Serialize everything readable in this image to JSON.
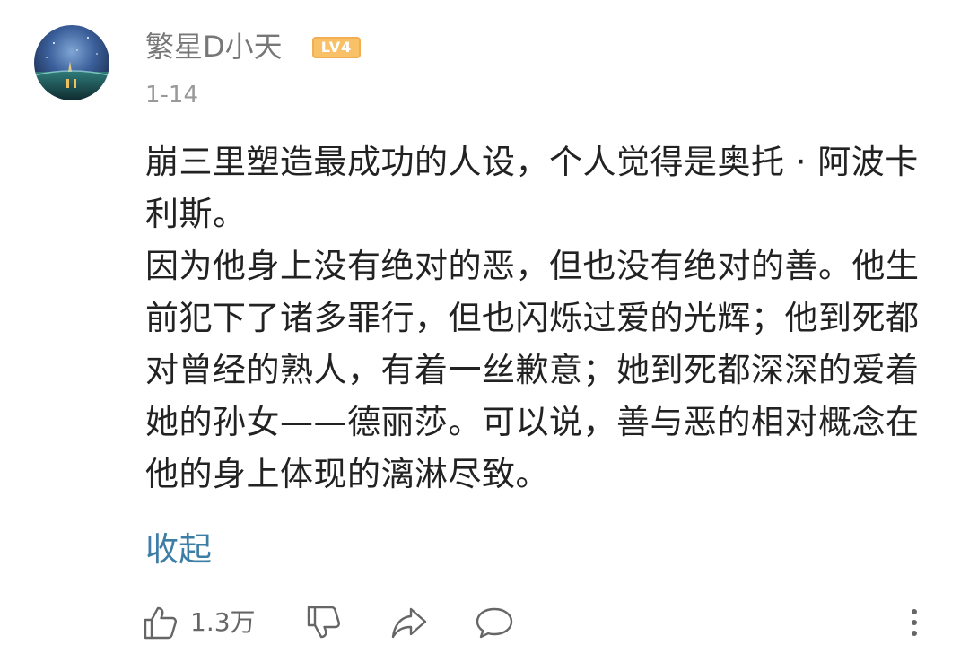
{
  "comment": {
    "username": "繁星D小天",
    "level_badge": "LV4",
    "date": "1-14",
    "paragraphs": [
      "崩三里塑造最成功的人设，个人觉得是奥托 · 阿波卡利斯。",
      "因为他身上没有绝对的恶，但也没有绝对的善。他生前犯下了诸多罪行，但也闪烁过爱的光辉；他到死都对曾经的熟人，有着一丝歉意；她到死都深深的爱着她的孙女——德丽莎。可以说，善与恶的相对概念在他的身上体现的漓淋尽致。"
    ],
    "collapse_label": "收起"
  },
  "actions": {
    "like_count": "1.3万"
  },
  "colors": {
    "username": "#777777",
    "body_text": "#222222",
    "link": "#3d7ea6",
    "badge_fill": "#f9c167",
    "badge_border": "#f2ae53",
    "icon": "#666666"
  },
  "icons": {
    "like": "thumbs-up-icon",
    "dislike": "thumbs-down-icon",
    "share": "share-arrow-icon",
    "reply": "comment-bubble-icon",
    "more": "more-vertical-icon"
  }
}
